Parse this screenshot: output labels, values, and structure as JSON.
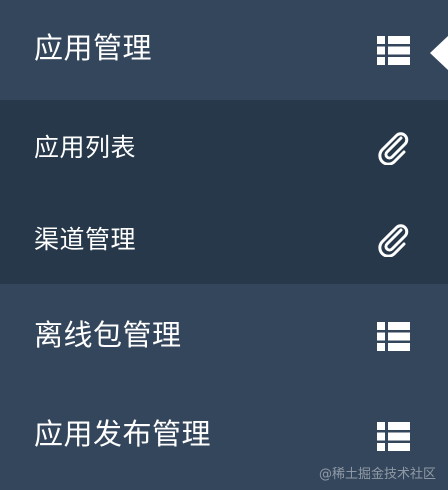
{
  "menu": {
    "app_management": {
      "label": "应用管理",
      "icon": "list-icon",
      "active": true
    },
    "submenu": [
      {
        "label": "应用列表",
        "icon": "paperclip-icon"
      },
      {
        "label": "渠道管理",
        "icon": "paperclip-icon"
      }
    ],
    "offline_package": {
      "label": "离线包管理",
      "icon": "list-icon"
    },
    "app_release": {
      "label": "应用发布管理",
      "icon": "list-icon"
    }
  },
  "watermark": "@稀土掘金技术社区",
  "colors": {
    "top_item_bg": "#34465c",
    "submenu_bg": "#26384a",
    "text": "#ffffff"
  }
}
